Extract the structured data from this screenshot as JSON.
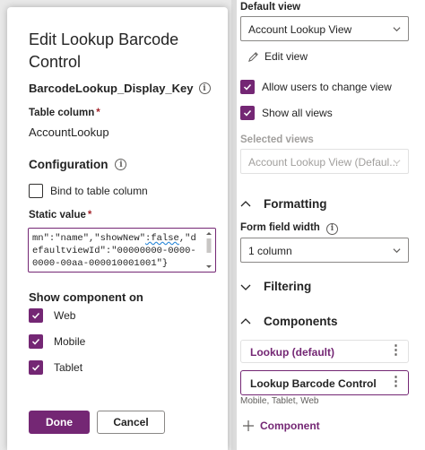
{
  "properties_pane": {
    "default_view_label": "Default view",
    "default_view_value": "Account Lookup View",
    "edit_view_label": "Edit view",
    "allow_change_view_label": "Allow users to change view",
    "show_all_views_label": "Show all views",
    "selected_views_label": "Selected views",
    "selected_views_value": "Account Lookup View (Defaul...",
    "formatting_label": "Formatting",
    "form_field_width_label": "Form field width",
    "form_field_width_value": "1 column",
    "filtering_label": "Filtering",
    "components_label": "Components",
    "components": [
      {
        "label": "Lookup (default)",
        "selected": false
      },
      {
        "label": "Lookup Barcode Control",
        "selected": true
      }
    ],
    "component_caption": "Mobile, Tablet, Web",
    "add_component_label": "Component"
  },
  "dialog": {
    "title": "Edit Lookup Barcode Control",
    "field_name": "BarcodeLookup_Display_Key",
    "table_column_label": "Table column",
    "table_column_required": "*",
    "table_column_value": "AccountLookup",
    "configuration_label": "Configuration",
    "bind_to_column_label": "Bind to table column",
    "static_value_label": "Static value",
    "static_value_required": "*",
    "static_value_part1": "mn\":\"name\",\"showNew\"",
    "static_value_part2": ":false",
    "static_value_part3": ",\"defaultviewId\":\"00000000-0000-0000-00aa-000010001001\"}",
    "show_component_on_label": "Show component on",
    "platforms": [
      {
        "label": "Web",
        "checked": true
      },
      {
        "label": "Mobile",
        "checked": true
      },
      {
        "label": "Tablet",
        "checked": true
      }
    ],
    "done_label": "Done",
    "cancel_label": "Cancel"
  },
  "colors": {
    "accent": "#742774",
    "required": "#a4262c"
  }
}
